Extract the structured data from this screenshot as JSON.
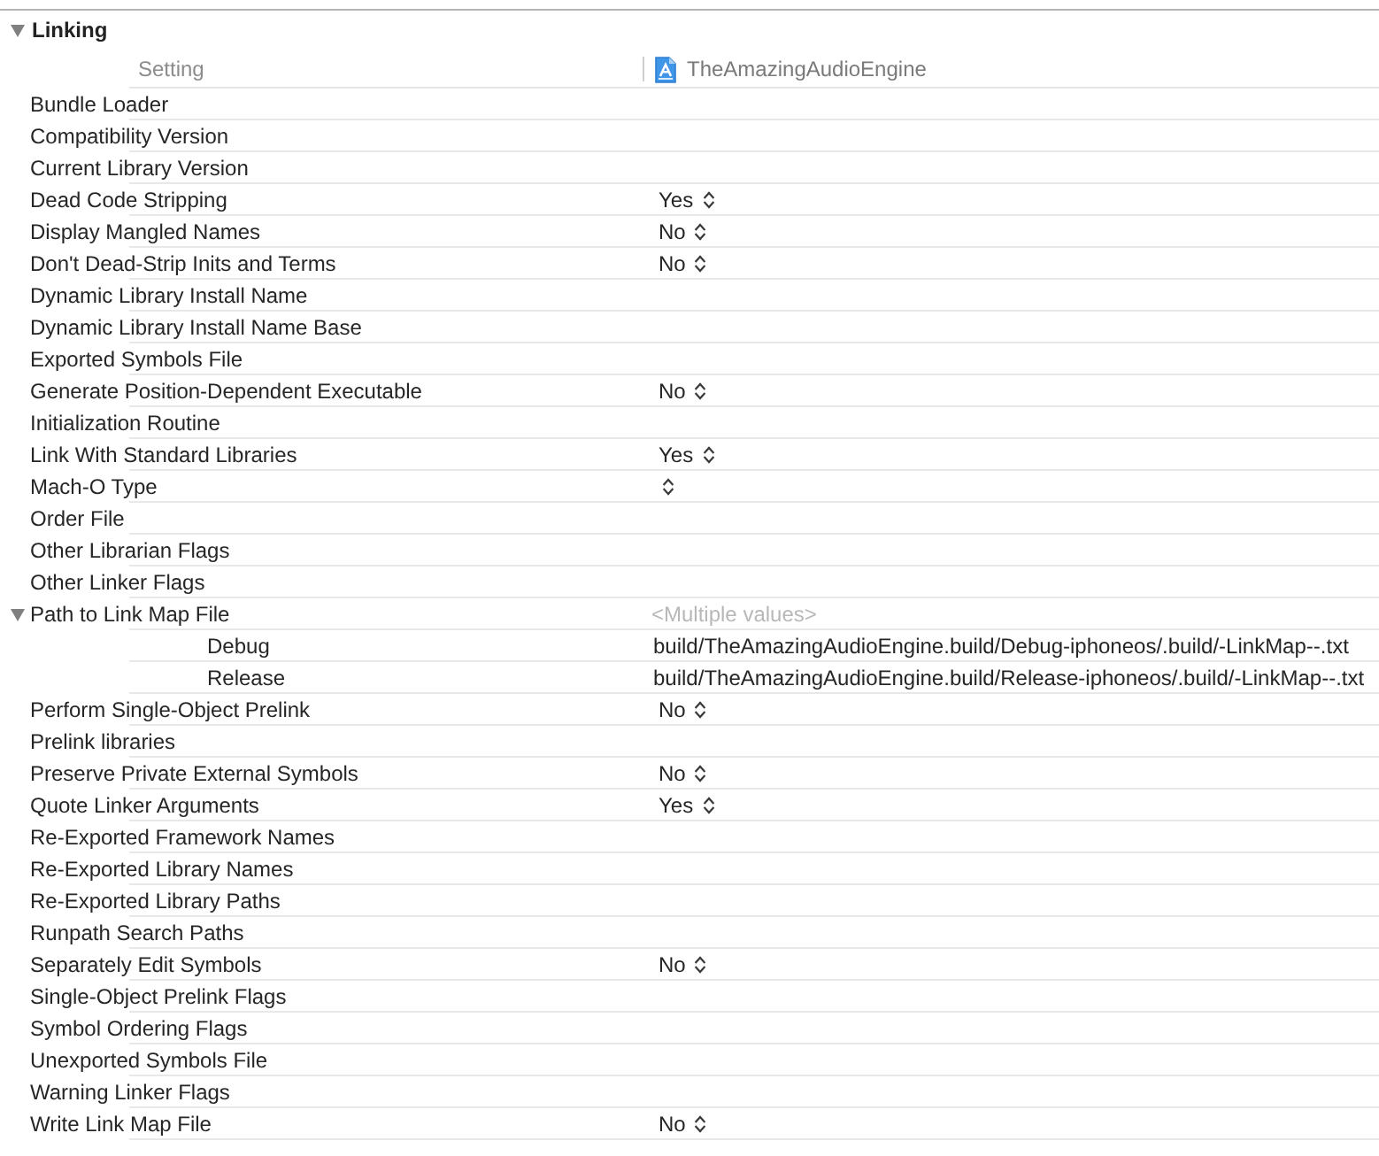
{
  "section": {
    "title": "Linking",
    "expanded": true
  },
  "columns": {
    "setting": "Setting",
    "target": "TheAmazingAudioEngine"
  },
  "settings": [
    {
      "name": "Bundle Loader",
      "kind": "empty"
    },
    {
      "name": "Compatibility Version",
      "kind": "empty"
    },
    {
      "name": "Current Library Version",
      "kind": "empty"
    },
    {
      "name": "Dead Code Stripping",
      "kind": "popup",
      "value": "Yes"
    },
    {
      "name": "Display Mangled Names",
      "kind": "popup",
      "value": "No"
    },
    {
      "name": "Don't Dead-Strip Inits and Terms",
      "kind": "popup",
      "value": "No"
    },
    {
      "name": "Dynamic Library Install Name",
      "kind": "empty"
    },
    {
      "name": "Dynamic Library Install Name Base",
      "kind": "empty"
    },
    {
      "name": "Exported Symbols File",
      "kind": "empty"
    },
    {
      "name": "Generate Position-Dependent Executable",
      "kind": "popup",
      "value": "No"
    },
    {
      "name": "Initialization Routine",
      "kind": "empty"
    },
    {
      "name": "Link With Standard Libraries",
      "kind": "popup",
      "value": "Yes"
    },
    {
      "name": "Mach-O Type",
      "kind": "popup"
    },
    {
      "name": "Order File",
      "kind": "empty"
    },
    {
      "name": "Other Librarian Flags",
      "kind": "empty"
    },
    {
      "name": "Other Linker Flags",
      "kind": "empty"
    },
    {
      "name": "Path to Link Map File",
      "kind": "mixed",
      "value": "<Multiple values>",
      "expanded": true,
      "children": [
        {
          "name": "Debug",
          "kind": "text",
          "value": "build/TheAmazingAudioEngine.build/Debug-iphoneos/.build/-LinkMap--.txt"
        },
        {
          "name": "Release",
          "kind": "text",
          "value": "build/TheAmazingAudioEngine.build/Release-iphoneos/.build/-LinkMap--.txt"
        }
      ]
    },
    {
      "name": "Perform Single-Object Prelink",
      "kind": "popup",
      "value": "No"
    },
    {
      "name": "Prelink libraries",
      "kind": "empty"
    },
    {
      "name": "Preserve Private External Symbols",
      "kind": "popup",
      "value": "No"
    },
    {
      "name": "Quote Linker Arguments",
      "kind": "popup",
      "value": "Yes"
    },
    {
      "name": "Re-Exported Framework Names",
      "kind": "empty"
    },
    {
      "name": "Re-Exported Library Names",
      "kind": "empty"
    },
    {
      "name": "Re-Exported Library Paths",
      "kind": "empty"
    },
    {
      "name": "Runpath Search Paths",
      "kind": "empty"
    },
    {
      "name": "Separately Edit Symbols",
      "kind": "popup",
      "value": "No"
    },
    {
      "name": "Single-Object Prelink Flags",
      "kind": "empty"
    },
    {
      "name": "Symbol Ordering Flags",
      "kind": "empty"
    },
    {
      "name": "Unexported Symbols File",
      "kind": "empty"
    },
    {
      "name": "Warning Linker Flags",
      "kind": "empty"
    },
    {
      "name": "Write Link Map File",
      "kind": "popup",
      "value": "No"
    }
  ]
}
